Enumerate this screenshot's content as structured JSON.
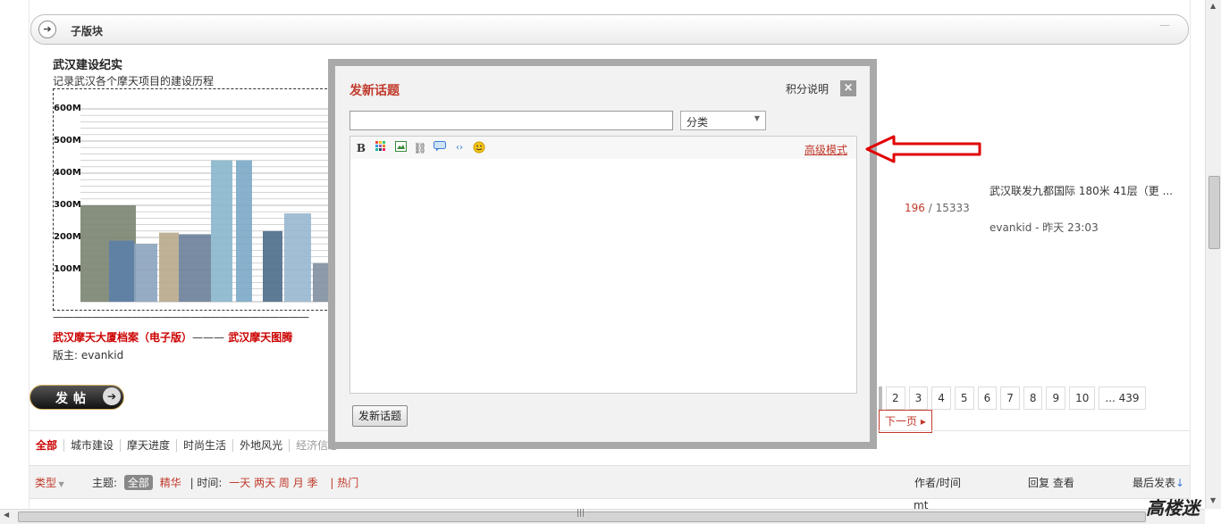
{
  "subforum_bar": {
    "title": "子版块"
  },
  "forum": {
    "title": "武汉建设纪实",
    "description": "记录武汉各个摩天项目的建设历程",
    "dash_line": "——————————————————————————",
    "link1": "武汉摩天大厦档案（电子版）",
    "separator": "———",
    "link2": "武汉摩天图腾",
    "moderator": "版主: evankid"
  },
  "chart_data": {
    "type": "bar",
    "categories": [],
    "values": [],
    "y_ticks": [
      "600M",
      "500M",
      "400M",
      "300M",
      "200M",
      "100M"
    ],
    "ylim": [
      0,
      600
    ]
  },
  "stats": {
    "posts": "196",
    "slash": " / ",
    "views": "15333"
  },
  "last_post": {
    "title": "武汉联发九都国际 180米 41层（更 ...",
    "user_time": "evankid - 昨天 23:03"
  },
  "post_button": {
    "label": "发帖"
  },
  "pager": {
    "pages": [
      "2",
      "3",
      "4",
      "5",
      "6",
      "7",
      "8",
      "9",
      "10",
      "... 439"
    ],
    "next": "下一页"
  },
  "category_tabs": [
    "全部",
    "城市建设",
    "摩天进度",
    "时尚生活",
    "外地风光",
    "经济信息"
  ],
  "list_header": {
    "type": "类型",
    "topic_label": "主题:",
    "all": "全部",
    "digest": "精华",
    "time_label": "| 时间:",
    "time_options": "一天 两天 周 月 季",
    "hot": "| 热门",
    "author_time": "作者/时间",
    "reply_view": "回复 查看",
    "last_post": "最后发表",
    "sort_arrow": "↓"
  },
  "row_peek": "mt",
  "modal": {
    "title": "发新话题",
    "rules_link": "积分说明",
    "close": "×",
    "subject_value": "",
    "category_value": "分类",
    "advanced_mode": "高级模式",
    "submit": "发新话题"
  },
  "watermark": "高楼迷",
  "colors": {
    "accent_red": "#c0392b",
    "link_red": "#cc0000",
    "modal_frame": "#a9a9a9"
  }
}
